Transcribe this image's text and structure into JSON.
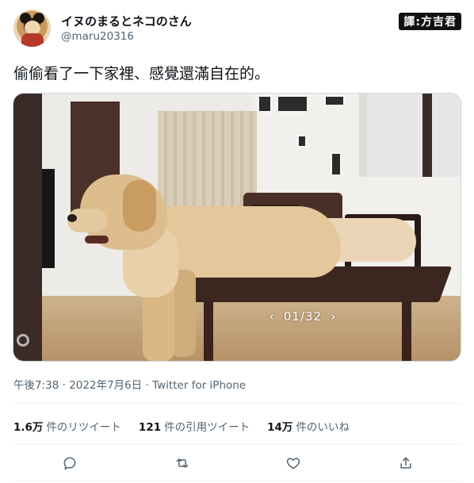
{
  "user": {
    "name": "イヌのまるとネコのさん",
    "handle": "@maru20316"
  },
  "translator_badge": "譯:方吉君",
  "tweet": {
    "text": "偷偷看了一下家裡、感覺還滿自在的。"
  },
  "media": {
    "counter": "01/32",
    "prev_icon": "chevron-left-icon",
    "next_icon": "chevron-right-icon"
  },
  "meta": {
    "time": "午後7:38",
    "date": "2022年7月6日",
    "source": "Twitter for iPhone",
    "separator": "·"
  },
  "stats": [
    {
      "value": "1.6万",
      "label": "件のリツイート"
    },
    {
      "value": "121",
      "label": "件の引用ツイート"
    },
    {
      "value": "14万",
      "label": "件のいいね"
    }
  ],
  "actions": [
    {
      "name": "reply-icon"
    },
    {
      "name": "retweet-icon"
    },
    {
      "name": "like-icon"
    },
    {
      "name": "share-icon"
    }
  ],
  "colors": {
    "text_primary": "#0f1419",
    "text_secondary": "#536471",
    "divider": "#eff3f4"
  }
}
